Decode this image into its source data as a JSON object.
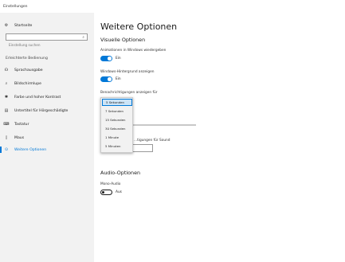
{
  "window": {
    "title": "Einstellungen"
  },
  "sidebar": {
    "home_label": "Startseite",
    "search_placeholder": "Einstellung suchen",
    "section_header": "Erleichterte Bedienung",
    "items": [
      {
        "label": "Sprachausgabe",
        "icon": "speech-icon"
      },
      {
        "label": "Bildschirmlupe",
        "icon": "magnifier-icon"
      },
      {
        "label": "Farbe und hoher Kontrast",
        "icon": "contrast-icon"
      },
      {
        "label": "Untertitel für Hörgeschädigte",
        "icon": "captions-icon"
      },
      {
        "label": "Tastatur",
        "icon": "keyboard-icon"
      },
      {
        "label": "Maus",
        "icon": "mouse-icon"
      },
      {
        "label": "Weitere Optionen",
        "icon": "more-options-icon",
        "active": true
      }
    ]
  },
  "main": {
    "title": "Weitere Optionen",
    "visual_heading": "Visuelle Optionen",
    "animations_label": "Animationen in Windows wiedergeben",
    "animations_state": "Ein",
    "background_label": "Windows-Hintergrund anzeigen",
    "background_state": "Ein",
    "notifications_label": "Benachrichtigungen anzeigen für",
    "notifications_options": [
      "5 Sekunden",
      "7 Sekunden",
      "15 Sekunden",
      "30 Sekunden",
      "1 Minute",
      "5 Minuten"
    ],
    "notifications_selected": "5 Sekunden",
    "partial_label": "...tigungen für Sound",
    "audio_heading": "Audio-Optionen",
    "mono_label": "Mono-Audio",
    "mono_state": "Aus"
  },
  "colors": {
    "accent": "#0078d7",
    "sidebar_bg": "#f2f2f2"
  }
}
